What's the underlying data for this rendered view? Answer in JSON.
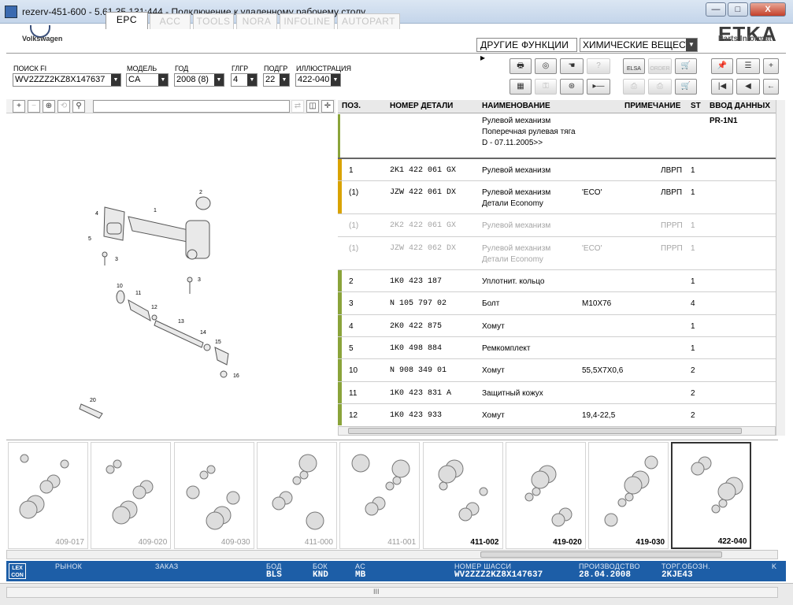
{
  "window": {
    "title": "rezerv-451-600 - 5.61.35.131:444 - Подключение к удаленному рабочему столу",
    "btn_min": "—",
    "btn_max": "□",
    "btn_close": "X"
  },
  "header": {
    "logo_text": "Volkswagen",
    "brand": "ETKA",
    "brand_sub": "Parts Informat",
    "tabs": [
      {
        "label": "EPC",
        "active": true
      },
      {
        "label": "ACC"
      },
      {
        "label": "TOOLS"
      },
      {
        "label": "NORA"
      },
      {
        "label": "INFOLINE"
      },
      {
        "label": "AUTOPART"
      }
    ],
    "other_functions": "ДРУГИЕ ФУНКЦИИ ▸",
    "function_select": "ХИМИЧЕСКИЕ ВЕЩЕСТВА"
  },
  "search": {
    "vin_label": "ПОИСК FI",
    "vin_value": "WV2ZZZ2KZ8X147637",
    "model_label": "МОДЕЛЬ",
    "model_value": "CA",
    "year_label": "ГОД",
    "year_value": "2008 (8)",
    "mg_label": "ГЛГР",
    "mg_value": "4",
    "sg_label": "ПОДГР",
    "sg_value": "22",
    "illus_label": "ИЛЛЮСТРАЦИЯ",
    "illus_value": "422-040"
  },
  "toolbar_icons": [
    "printer-icon",
    "cd-icon",
    "hand-icon",
    "question-icon",
    "elsa-icon",
    "cart-icon",
    "pin-icon",
    "list-icon",
    "cart-add-icon",
    "calculator-icon",
    "key-icon",
    "steering-icon",
    "play-icon",
    "bookmark-icon",
    "orderlist-icon",
    "order-icon",
    "first-icon",
    "prev-icon",
    "back-icon"
  ],
  "toolbar": {
    "elsa": "ELSA",
    "order": "ORDER"
  },
  "table": {
    "headers": {
      "pos": "ПОЗ.",
      "part": "НОМЕР ДЕТАЛИ",
      "name": "НАИМЕНОВАНИЕ",
      "note": "ПРИМЕЧАНИЕ",
      "st": "ST",
      "input": "ВВОД ДАННЫХ"
    },
    "group": {
      "line1": "Рулевой механизм",
      "line2": "Поперечная рулевая тяга",
      "line3": "D - 07.11.2005>>",
      "input": "PR-1N1"
    },
    "rows": [
      {
        "pos": "1",
        "part": "2K1  422  061  GX",
        "name": "Рулевой механизм",
        "name2": "",
        "note": "",
        "side": "ЛВРП",
        "st": "1",
        "grey": false,
        "color": "#d9a300"
      },
      {
        "pos": "(1)",
        "part": "JZW  422  061  DX",
        "name": "Рулевой механизм",
        "name2": "Детали Economy",
        "note": "'ECO'",
        "side": "ЛВРП",
        "st": "1",
        "grey": false,
        "color": "#d9a300"
      },
      {
        "pos": "(1)",
        "part": "2K2  422  061  GX",
        "name": "Рулевой механизм",
        "name2": "",
        "note": "",
        "side": "ПРРП",
        "st": "1",
        "grey": true,
        "color": ""
      },
      {
        "pos": "(1)",
        "part": "JZW  422  062  DX",
        "name": "Рулевой механизм",
        "name2": "Детали Economy",
        "note": "'ECO'",
        "side": "ПРРП",
        "st": "1",
        "grey": true,
        "color": ""
      },
      {
        "pos": "2",
        "part": "1K0  423  187",
        "name": "Уплотнит. кольцо",
        "name2": "",
        "note": "",
        "side": "",
        "st": "1",
        "grey": false,
        "color": "#8aa43a"
      },
      {
        "pos": "3",
        "part": "N    105  797  02",
        "name": "Болт",
        "name2": "",
        "note": "M10X76",
        "side": "",
        "st": "4",
        "grey": false,
        "color": "#8aa43a"
      },
      {
        "pos": "4",
        "part": "2K0  422  875",
        "name": "Хомут",
        "name2": "",
        "note": "",
        "side": "",
        "st": "1",
        "grey": false,
        "color": "#8aa43a"
      },
      {
        "pos": "5",
        "part": "1K0  498  884",
        "name": "Ремкомплект",
        "name2": "",
        "note": "",
        "side": "",
        "st": "1",
        "grey": false,
        "color": "#8aa43a"
      },
      {
        "pos": "10",
        "part": "N    908  349  01",
        "name": "Хомут",
        "name2": "",
        "note": "55,5X7X0,6",
        "side": "",
        "st": "2",
        "grey": false,
        "color": "#8aa43a"
      },
      {
        "pos": "11",
        "part": "1K0  423  831  A",
        "name": "Защитный кожух",
        "name2": "",
        "note": "",
        "side": "",
        "st": "2",
        "grey": false,
        "color": "#8aa43a"
      },
      {
        "pos": "12",
        "part": "1K0  423  933",
        "name": "Хомут",
        "name2": "",
        "note": "19,4-22,5",
        "side": "",
        "st": "2",
        "grey": false,
        "color": "#8aa43a"
      }
    ]
  },
  "thumbnails": [
    {
      "label": "409-017",
      "dark": false
    },
    {
      "label": "409-020",
      "dark": false
    },
    {
      "label": "409-030",
      "dark": false
    },
    {
      "label": "411-000",
      "dark": false
    },
    {
      "label": "411-001",
      "dark": false
    },
    {
      "label": "411-002",
      "dark": true
    },
    {
      "label": "419-020",
      "dark": true
    },
    {
      "label": "419-030",
      "dark": true
    },
    {
      "label": "422-040",
      "dark": true,
      "selected": true
    }
  ],
  "illustration_labels": [
    "1",
    "2",
    "3",
    "3",
    "4",
    "5",
    "10",
    "11",
    "12",
    "13",
    "14",
    "15",
    "16",
    "20"
  ],
  "status": {
    "lex": "LEX CON",
    "market_label": "РЫНОК",
    "order_label": "ЗАКАЗ",
    "bod_label": "БОД",
    "bod_value": "BLS",
    "bok_label": "БОК",
    "bok_value": "KND",
    "ac_label": "AC",
    "ac_value": "MB",
    "chassis_label": "НОМЕР ШАССИ",
    "chassis_value": "WV2ZZZ2KZ8X147637",
    "prod_label": "ПРОИЗВОДСТВО",
    "prod_value": "28.04.2008",
    "trade_label": "ТОРГ.ОБОЗН.",
    "trade_value": "2KJE43",
    "k_label": "K"
  },
  "bottom": {
    "grip": "III"
  }
}
